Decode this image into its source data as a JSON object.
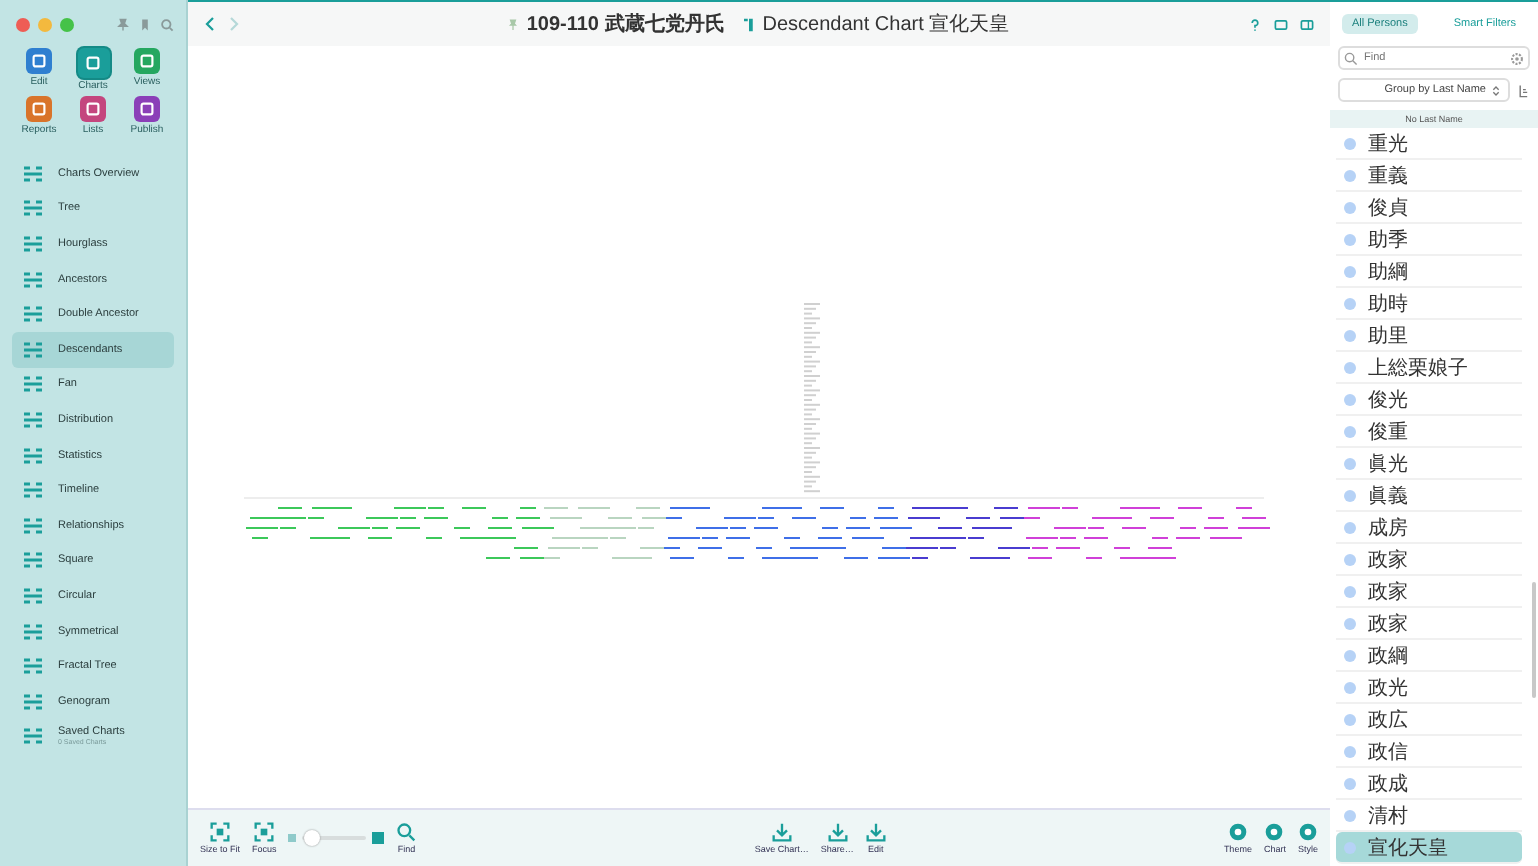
{
  "window": {
    "title": "109-110 武蔵七党丹氏",
    "chart_title": "Descendant Chart 宣化天皇"
  },
  "toolbar_buttons": [
    {
      "label": "Edit",
      "color": "#2f7fd0",
      "selected": false
    },
    {
      "label": "Charts",
      "color": "#1a9e9a",
      "selected": true
    },
    {
      "label": "Views",
      "color": "#25a760",
      "selected": false
    },
    {
      "label": "Reports",
      "color": "#d9742a",
      "selected": false
    },
    {
      "label": "Lists",
      "color": "#c4467e",
      "selected": false
    },
    {
      "label": "Publish",
      "color": "#8b3fb8",
      "selected": false
    }
  ],
  "sidebar": {
    "items": [
      {
        "label": "Charts Overview",
        "selected": false
      },
      {
        "label": "Tree",
        "selected": false
      },
      {
        "label": "Hourglass",
        "selected": false
      },
      {
        "label": "Ancestors",
        "selected": false
      },
      {
        "label": "Double Ancestor",
        "selected": false
      },
      {
        "label": "Descendants",
        "selected": true
      },
      {
        "label": "Fan",
        "selected": false
      },
      {
        "label": "Distribution",
        "selected": false
      },
      {
        "label": "Statistics",
        "selected": false
      },
      {
        "label": "Timeline",
        "selected": false
      },
      {
        "label": "Relationships",
        "selected": false
      },
      {
        "label": "Square",
        "selected": false
      },
      {
        "label": "Circular",
        "selected": false
      },
      {
        "label": "Symmetrical",
        "selected": false
      },
      {
        "label": "Fractal Tree",
        "selected": false
      },
      {
        "label": "Genogram",
        "selected": false
      },
      {
        "label": "Saved Charts",
        "subtitle": "0 Saved Charts",
        "selected": false
      }
    ]
  },
  "bottom_toolbar": {
    "left": [
      "Size to Fit",
      "Focus"
    ],
    "zoom": {
      "level": 0.15
    },
    "find": "Find",
    "center": [
      "Save Chart…",
      "Share…",
      "Edit"
    ],
    "right": [
      "Theme",
      "Chart",
      "Style"
    ]
  },
  "persons_panel": {
    "tabs": [
      {
        "label": "All Persons",
        "selected": true
      },
      {
        "label": "Smart Filters",
        "selected": false
      }
    ],
    "search": {
      "placeholder": "Find"
    },
    "group_by": "Group by Last Name",
    "section_header": "No Last Name",
    "persons": [
      {
        "name": "重光",
        "selected": false
      },
      {
        "name": "重義",
        "selected": false
      },
      {
        "name": "俊貞",
        "selected": false
      },
      {
        "name": "助季",
        "selected": false
      },
      {
        "name": "助綱",
        "selected": false
      },
      {
        "name": "助時",
        "selected": false
      },
      {
        "name": "助里",
        "selected": false
      },
      {
        "name": "上総栗娘子",
        "selected": false
      },
      {
        "name": "俊光",
        "selected": false
      },
      {
        "name": "俊重",
        "selected": false
      },
      {
        "name": "眞光",
        "selected": false
      },
      {
        "name": "眞義",
        "selected": false
      },
      {
        "name": "成房",
        "selected": false
      },
      {
        "name": "政家",
        "selected": false
      },
      {
        "name": "政家",
        "selected": false
      },
      {
        "name": "政家",
        "selected": false
      },
      {
        "name": "政綱",
        "selected": false
      },
      {
        "name": "政光",
        "selected": false
      },
      {
        "name": "政広",
        "selected": false
      },
      {
        "name": "政信",
        "selected": false
      },
      {
        "name": "政成",
        "selected": false
      },
      {
        "name": "清村",
        "selected": false
      },
      {
        "name": "宣化天皇",
        "selected": true
      }
    ]
  }
}
